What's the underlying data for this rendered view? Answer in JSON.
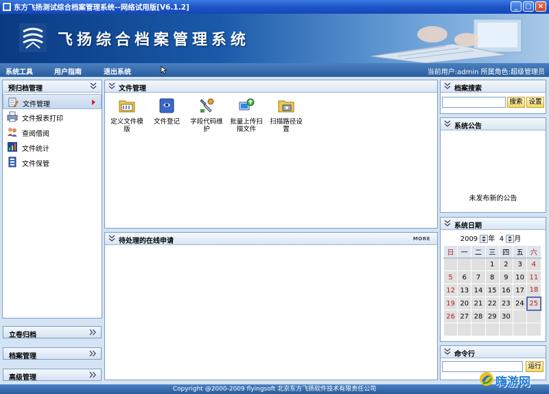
{
  "window": {
    "title": "东方飞扬测试综合档案管理系统--网络试用版[V6.1.2]",
    "controls": [
      "_",
      "□",
      "×"
    ]
  },
  "banner": {
    "title": "飞扬综合档案管理系统"
  },
  "menubar": {
    "items": [
      "系统工具",
      "用户指南",
      "退出系统"
    ],
    "user_info": "当前用户:admin  所属角色:超级管理员"
  },
  "left_panel": {
    "title": "预归档管理",
    "items": [
      {
        "label": "文件管理",
        "icon": "edit-document-icon",
        "active": true
      },
      {
        "label": "文件报表打印",
        "icon": "print-report-icon",
        "active": false
      },
      {
        "label": "查阅借阅",
        "icon": "borrow-people-icon",
        "active": false
      },
      {
        "label": "文件统计",
        "icon": "statistics-icon",
        "active": false
      },
      {
        "label": "文件保管",
        "icon": "storage-icon",
        "active": false
      }
    ],
    "sections": [
      "立卷归档",
      "档案管理",
      "高级管理"
    ]
  },
  "file_panel": {
    "title": "文件管理",
    "tools": [
      {
        "label": "定义文件模版",
        "icon": "folder-template-icon"
      },
      {
        "label": "文件登记",
        "icon": "register-icon"
      },
      {
        "label": "字段代码维护",
        "icon": "field-code-icon"
      },
      {
        "label": "批量上传扫描文件",
        "icon": "batch-upload-icon"
      },
      {
        "label": "扫描路径设置",
        "icon": "scan-path-icon"
      }
    ]
  },
  "pending_panel": {
    "title": "待处理的在线申请",
    "more_label": "MORE"
  },
  "search_panel": {
    "title": "档案搜索",
    "input_value": "",
    "search_label": "搜索",
    "settings_label": "设置"
  },
  "notice_panel": {
    "title": "系统公告",
    "message": "未发布新的公告"
  },
  "calendar_panel": {
    "title": "系统日期",
    "year": "2009",
    "year_suffix": "年",
    "month": "4",
    "month_suffix": "月",
    "weekdays": [
      "日",
      "一",
      "二",
      "三",
      "四",
      "五",
      "六"
    ],
    "weeks": [
      [
        "",
        "",
        "",
        "1",
        "2",
        "3",
        "4"
      ],
      [
        "5",
        "6",
        "7",
        "8",
        "9",
        "10",
        "11"
      ],
      [
        "12",
        "13",
        "14",
        "15",
        "16",
        "17",
        "18"
      ],
      [
        "19",
        "20",
        "21",
        "22",
        "23",
        "24",
        "25"
      ],
      [
        "26",
        "27",
        "28",
        "29",
        "30",
        "",
        ""
      ],
      [
        "",
        "",
        "",
        "",
        "",
        "",
        ""
      ]
    ],
    "today": "25"
  },
  "command_panel": {
    "title": "命令行",
    "input_value": "",
    "run_label": "运行"
  },
  "footer": {
    "text": "Copyright @2000-2009 flyingsoft 北京东方飞扬软件技术有限责任公司"
  },
  "watermark": {
    "text": "嗨游网"
  },
  "colors": {
    "titlebar": "#1d55c8",
    "menubar": "#2a5c9c",
    "panel_border": "#7a9cc6",
    "today_border": "#5a68b8",
    "weekend_text": "#b02020"
  }
}
